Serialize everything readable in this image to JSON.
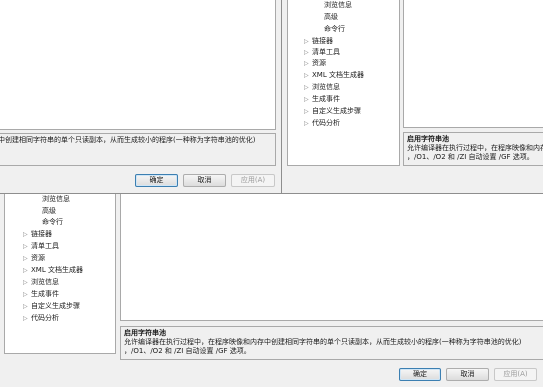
{
  "tree_labels": {
    "browse_info": "浏览信息",
    "advanced": "高级",
    "command_line": "命令行"
  },
  "tree_nodes": [
    "链接器",
    "清单工具",
    "资源",
    "XML 文档生成器",
    "浏览信息",
    "生成事件",
    "自定义生成步骤",
    "代码分析"
  ],
  "description": {
    "title": "启用字符串池",
    "line_full": "允许编译器在执行过程中，在程序映像和内存中创建相同字符串的单个只读副本，从而生成较小的程序(一种称为字符串池的优化)",
    "line_partial_a": "中创建相同字符串的单个只读副本，从而生成较小的程序(一种称为字符串池的优化)",
    "line_partial_b": "允许编译器在执行过程中，在程序映像和内存中",
    "line2": "，/O1、/O2 和 /ZI 自动设置 /GF 选项。"
  },
  "buttons": {
    "ok": "确定",
    "cancel": "取消",
    "apply": "应用(A)"
  }
}
